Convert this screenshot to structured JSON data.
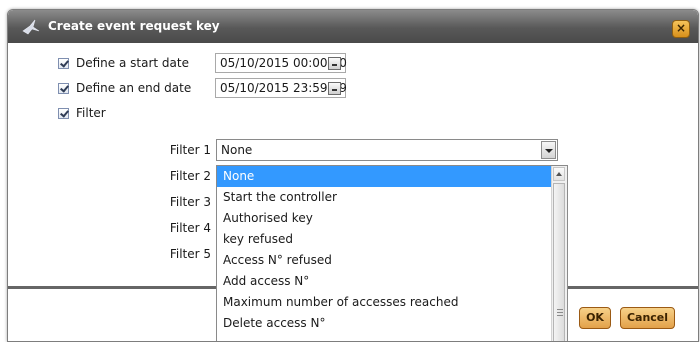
{
  "dialog": {
    "title": "Create event request key",
    "close_symbol": "×"
  },
  "form": {
    "start": {
      "label": "Define a start date",
      "checked": true,
      "value": "05/10/2015 00:00:00"
    },
    "end": {
      "label": "Define an end date",
      "checked": true,
      "value": "05/10/2015 23:59:59"
    },
    "filter": {
      "label": "Filter",
      "checked": true
    },
    "filter_labels": [
      "Filter 1",
      "Filter 2",
      "Filter 3",
      "Filter 4",
      "Filter 5"
    ],
    "filter1_selected": "None"
  },
  "dropdown": {
    "options": [
      "None",
      "Start the controller",
      "Authorised key",
      "key refused",
      "Access N° refused",
      "Add access N°",
      "Maximum number of accesses reached",
      "Delete access N°"
    ]
  },
  "buttons": {
    "ok": "OK",
    "cancel": "Cancel"
  },
  "colors": {
    "selection": "#3399ff",
    "button": "#e8ad57",
    "titlebar": "#5a5a5a"
  }
}
